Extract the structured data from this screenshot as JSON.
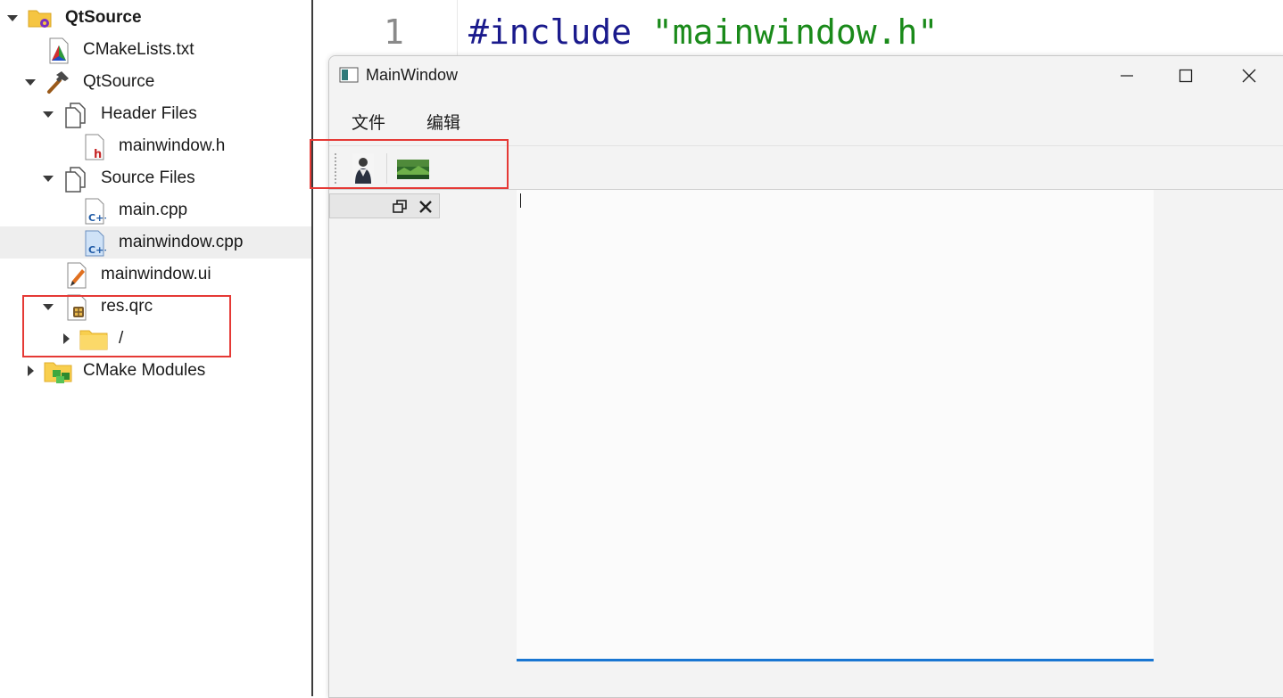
{
  "tree": {
    "items": [
      {
        "label": "QtSource",
        "icon": "project-folder-gear-icon"
      },
      {
        "label": "CMakeLists.txt",
        "icon": "cmake-file-icon"
      },
      {
        "label": "QtSource",
        "icon": "hammer-icon"
      },
      {
        "label": "Header Files",
        "icon": "files-folder-icon"
      },
      {
        "label": "mainwindow.h",
        "icon": "header-file-icon"
      },
      {
        "label": "Source Files",
        "icon": "files-folder-icon"
      },
      {
        "label": "main.cpp",
        "icon": "cpp-file-icon"
      },
      {
        "label": "mainwindow.cpp",
        "icon": "cpp-file-icon"
      },
      {
        "label": "mainwindow.ui",
        "icon": "ui-file-icon"
      },
      {
        "label": "res.qrc",
        "icon": "resource-file-icon"
      },
      {
        "label": "/",
        "icon": "folder-icon"
      },
      {
        "label": "CMake Modules",
        "icon": "cmake-modules-icon"
      }
    ],
    "selected_index": 7
  },
  "editor": {
    "line_number": "1",
    "code_keyword": "#include",
    "code_string": "\"mainwindow.h\""
  },
  "window": {
    "title": "MainWindow",
    "menus": [
      "文件",
      "编辑"
    ],
    "toolbar_actions": [
      "person-photo-icon",
      "landscape-photo-icon"
    ]
  },
  "colors": {
    "highlight_red": "#e53935",
    "focus_blue": "#1976d2",
    "keyword_blue": "#1a1a8c",
    "string_green": "#1a8a1a"
  }
}
